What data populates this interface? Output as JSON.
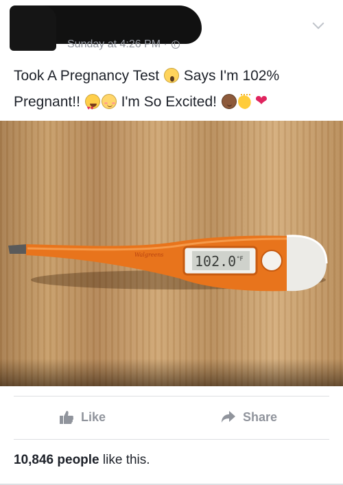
{
  "post": {
    "timestamp": "Sunday at 4:26 PM · ",
    "text_parts": {
      "a": "Took A Pregnancy Test ",
      "b": " Says I'm 102%",
      "c": "Pregnant!! ",
      "d": " I'm So Excited! "
    },
    "photo": {
      "brand_text": "Walgreens",
      "display_reading": "102.0",
      "display_unit": "°F"
    }
  },
  "actions": {
    "like_label": "Like",
    "share_label": "Share"
  },
  "likes": {
    "count": "10,846 people",
    "suffix": " like this."
  },
  "icons": {
    "header_menu": "chevron-down-icon",
    "audience": "globe-icon",
    "like": "thumbs-up-icon",
    "share": "share-arrow-icon"
  },
  "colors": {
    "meta_gray": "#90949c",
    "text": "#1d2129",
    "thermometer_orange": "#e8741c",
    "heart_red": "#e0245e"
  }
}
